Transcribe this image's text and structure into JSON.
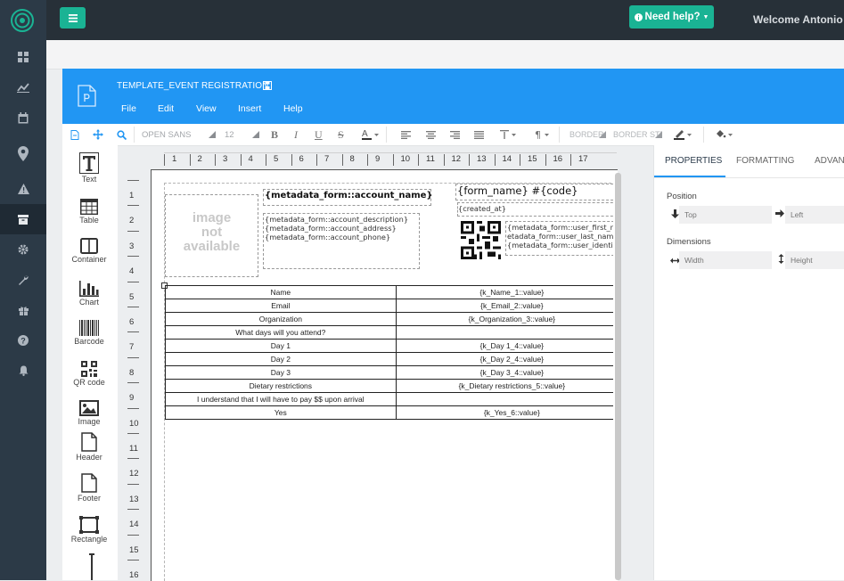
{
  "nav": {
    "items": [
      {
        "icon": "dashboard-icon"
      },
      {
        "icon": "chart-line-icon"
      },
      {
        "icon": "calendar-icon"
      },
      {
        "icon": "map-marker-icon"
      },
      {
        "icon": "warning-icon"
      },
      {
        "icon": "archive-icon"
      },
      {
        "icon": "gear-icon"
      },
      {
        "icon": "wrench-icon"
      },
      {
        "icon": "gift-icon"
      },
      {
        "icon": "question-icon"
      },
      {
        "icon": "bell-icon"
      }
    ]
  },
  "topbar": {
    "help_label": "Need help?",
    "welcome": "Welcome Antonio"
  },
  "editor": {
    "title": "TEMPLATE_EVENT REGISTRATION",
    "menu": [
      "File",
      "Edit",
      "View",
      "Insert",
      "Help"
    ]
  },
  "toolbar": {
    "font_name": "OPEN SANS",
    "font_size": "12",
    "border_label": "BORDER",
    "border_style_label": "BORDER STYLE"
  },
  "tools": [
    {
      "label": "Text",
      "icon": "text-icon"
    },
    {
      "label": "Table",
      "icon": "table-icon"
    },
    {
      "label": "Container",
      "icon": "container-icon"
    },
    {
      "label": "Chart",
      "icon": "bar-chart-icon"
    },
    {
      "label": "Barcode",
      "icon": "barcode-icon"
    },
    {
      "label": "QR code",
      "icon": "qr-code-icon"
    },
    {
      "label": "Image",
      "icon": "image-icon"
    },
    {
      "label": "Header",
      "icon": "header-icon"
    },
    {
      "label": "Footer",
      "icon": "footer-icon"
    },
    {
      "label": "Rectangle",
      "icon": "rectangle-icon"
    }
  ],
  "ruler": {
    "h": [
      "1",
      "2",
      "3",
      "4",
      "5",
      "6",
      "7",
      "8",
      "9",
      "10",
      "11",
      "12",
      "13",
      "14",
      "15",
      "16",
      "17"
    ],
    "v": [
      "1",
      "2",
      "3",
      "4",
      "5",
      "6",
      "7",
      "8",
      "9",
      "10",
      "11",
      "12",
      "13",
      "14",
      "15",
      "16"
    ]
  },
  "canvas": {
    "image_placeholder": [
      "image",
      "not",
      "available"
    ],
    "account_name": "{metadata_form::account_name}",
    "account_lines": [
      "{metadata_form::account_description}",
      "{metadata_form::account_address}",
      "{metadata_form::account_phone}"
    ],
    "form_name": "{form_name} #{code}",
    "created_at": "{created_at}",
    "user_lines": [
      "{metadata_form::user_first_n",
      "etadata_form::user_last_nam",
      "{metadata_form::user_identi"
    ],
    "rows": [
      {
        "label": "Name",
        "value": "{k_Name_1::value}"
      },
      {
        "label": "Email",
        "value": "{k_Email_2::value}"
      },
      {
        "label": "Organization",
        "value": "{k_Organization_3::value}"
      },
      {
        "label": "What days will you attend?",
        "value": ""
      },
      {
        "label": "Day 1",
        "value": "{k_Day 1_4::value}"
      },
      {
        "label": "Day 2",
        "value": "{k_Day 2_4::value}"
      },
      {
        "label": "Day 3",
        "value": "{k_Day 3_4::value}"
      },
      {
        "label": "Dietary restrictions",
        "value": "{k_Dietary restrictions_5::value}"
      },
      {
        "label": "I understand that I will have to pay $$ upon arrival",
        "value": ""
      },
      {
        "label": "Yes",
        "value": "{k_Yes_6::value}"
      }
    ]
  },
  "props": {
    "tabs": [
      "PROPERTIES",
      "FORMATTING",
      "ADVANCED"
    ],
    "position_label": "Position",
    "top_placeholder": "Top",
    "left_placeholder": "Left",
    "dimensions_label": "Dimensions",
    "width_placeholder": "Width",
    "height_placeholder": "Height"
  },
  "colors": {
    "accent": "#2196f3",
    "brand": "#1ab394",
    "nav": "#2c3a47"
  }
}
